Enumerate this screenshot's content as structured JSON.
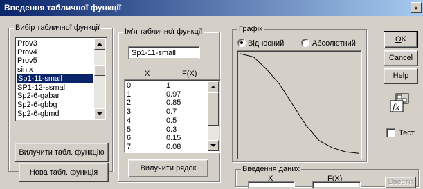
{
  "window": {
    "title": "Введення табличної функції",
    "close_glyph": "x"
  },
  "select_group": {
    "legend": "Вибір табличної функції",
    "items": [
      "Prov3",
      "Prov4",
      "Prov5",
      "sin x",
      "Sp1-11-small",
      "SP1-12-ssmal",
      "Sp2-6-gabar",
      "Sp2-6-gbbg",
      "Sp2-6-gbmd"
    ],
    "selected_index": 4,
    "delete_button": "Вилучити табл. функцію"
  },
  "new_button": "Нова табл. функція",
  "name_group": {
    "legend": "Ім'я табличної функції",
    "value": "Sp1-11-small",
    "col_x": "X",
    "col_fx": "F(X)",
    "rows": [
      {
        "x": "0",
        "fx": "1"
      },
      {
        "x": "1",
        "fx": "0.97"
      },
      {
        "x": "2",
        "fx": "0.85"
      },
      {
        "x": "3",
        "fx": "0.7"
      },
      {
        "x": "4",
        "fx": "0.5"
      },
      {
        "x": "5",
        "fx": "0.3"
      },
      {
        "x": "6",
        "fx": "0.15"
      },
      {
        "x": "7",
        "fx": "0.08"
      }
    ],
    "delete_row_button": "Вилучити рядок"
  },
  "graph_group": {
    "legend": "Графік",
    "radio_relative": "Відносний",
    "radio_absolute": "Абсолютний",
    "selected": "relative",
    "curve": [
      [
        0,
        1
      ],
      [
        1,
        0.97
      ],
      [
        2,
        0.85
      ],
      [
        3,
        0.7
      ],
      [
        4,
        0.5
      ],
      [
        5,
        0.3
      ],
      [
        6,
        0.15
      ],
      [
        7,
        0.08
      ],
      [
        8,
        0.04
      ],
      [
        9,
        0.025
      ]
    ]
  },
  "input_group": {
    "legend": "Введення даних",
    "label_x": "X",
    "label_fx": "F(X)",
    "value_x": "",
    "value_fx": "",
    "enter_button": "Ввести"
  },
  "buttons": {
    "ok_mn": "O",
    "ok_rest": "K",
    "cancel_mn": "C",
    "cancel_rest": "ancel",
    "help_mn": "H",
    "help_rest": "elp"
  },
  "test_checkbox": {
    "label": "Тест",
    "checked": false
  },
  "icons": {
    "fx_icon": "fx-function-icon"
  },
  "colors": {
    "selection": "#0a246a",
    "face": "#d4d0c8",
    "title_start": "#0a246a",
    "title_end": "#a6caf0"
  }
}
